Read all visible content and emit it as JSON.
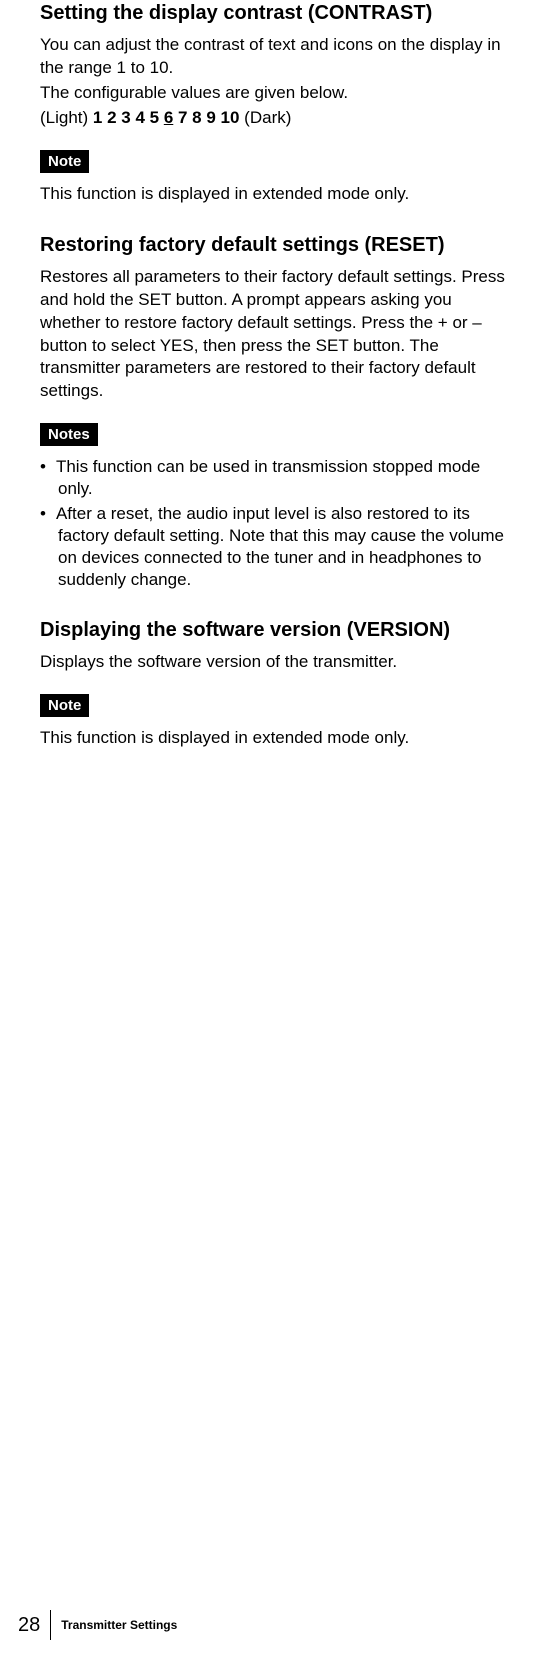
{
  "sections": {
    "contrast": {
      "heading": "Setting the display contrast (CONTRAST)",
      "body1": "You can adjust the contrast of text and icons on the display in the range 1 to 10.",
      "body2": "The configurable values are given below.",
      "values_light": "(Light) ",
      "values_numbers_pre": "1 2 3 4 5 ",
      "values_default": "6",
      "values_numbers_post": " 7 8 9 10",
      "values_dark": " (Dark)",
      "note_label": "Note",
      "note_text": "This function is displayed in extended mode only."
    },
    "reset": {
      "heading": "Restoring factory default settings (RESET)",
      "body": "Restores all parameters to their factory default settings. Press and hold the SET button. A prompt appears asking you whether to restore factory default settings. Press the + or – button to select YES, then press the SET button. The transmitter parameters are restored to their factory default settings.",
      "notes_label": "Notes",
      "note1": "This function can be used in transmission stopped mode only.",
      "note2": "After a reset, the audio input level is also restored to its factory default setting. Note that this may cause the volume on devices connected to the tuner and in headphones to suddenly change."
    },
    "version": {
      "heading": "Displaying the software version (VERSION)",
      "body": "Displays the software version of the transmitter.",
      "note_label": "Note",
      "note_text": "This function is displayed in extended mode only."
    }
  },
  "footer": {
    "page_number": "28",
    "title": "Transmitter Settings"
  }
}
